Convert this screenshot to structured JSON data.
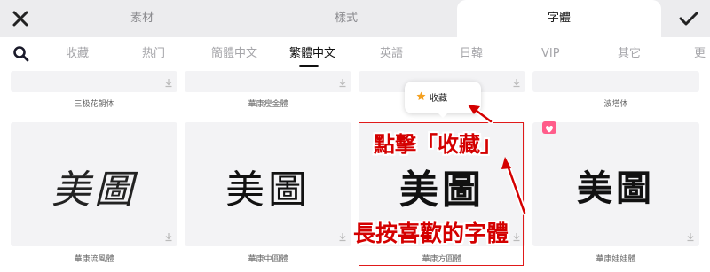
{
  "top_bar": {
    "tabs": [
      {
        "label": "素材",
        "active": false
      },
      {
        "label": "樣式",
        "active": false
      },
      {
        "label": "字體",
        "active": true
      }
    ],
    "close_icon": "close-icon",
    "confirm_icon": "checkmark-icon"
  },
  "categories": {
    "search_icon": "search-icon",
    "items": [
      "收藏",
      "热门",
      "簡體中文",
      "繁體中文",
      "英語",
      "日韓",
      "VIP",
      "其它",
      "更"
    ],
    "active": "繁體中文"
  },
  "fonts_row_top": [
    "三极花朝体",
    "華康瘦金體",
    "",
    "波塔体"
  ],
  "fonts_row_main": [
    {
      "name": "華康流風體",
      "preview": "美圖"
    },
    {
      "name": "華康中圓體",
      "preview": "美圖"
    },
    {
      "name": "華康方圓體",
      "preview": "美圖"
    },
    {
      "name": "華康娃娃體",
      "preview": "美圖"
    }
  ],
  "popup": {
    "label": "收藏",
    "icon": "star-icon"
  },
  "annotations": {
    "tap_favorite": "點擊「收藏」",
    "long_press": "長按喜歡的字體"
  },
  "colors": {
    "accent_red": "#d40000",
    "star": "#f4a020",
    "badge": "#ff5c8a"
  }
}
